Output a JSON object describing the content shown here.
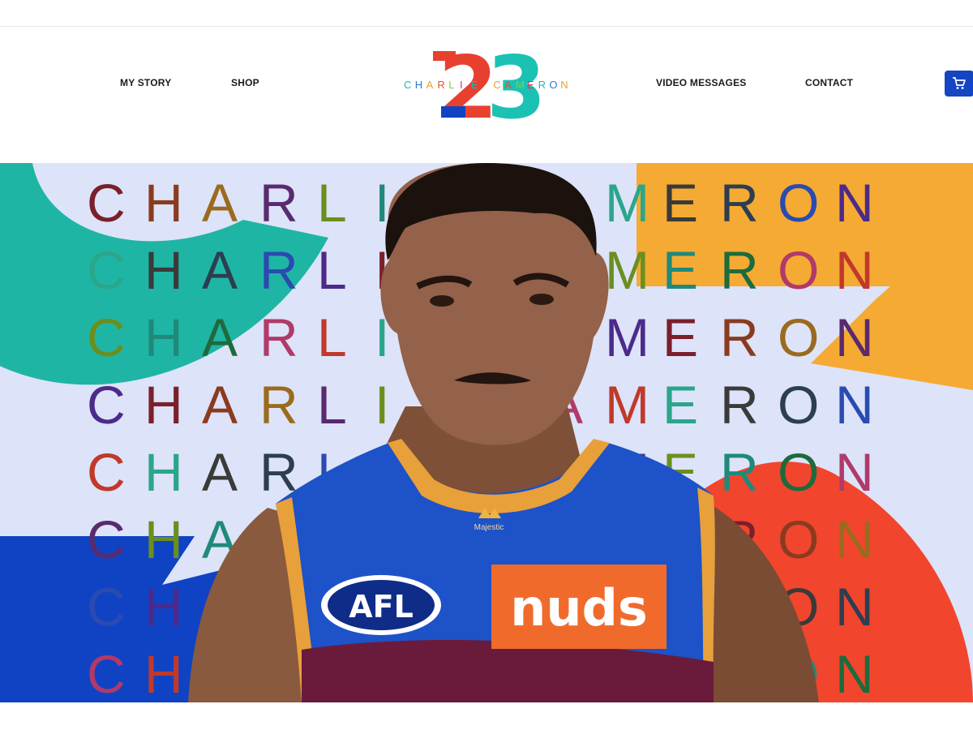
{
  "nav": {
    "left": [
      {
        "label": "MY STORY"
      },
      {
        "label": "SHOP"
      }
    ],
    "right": [
      {
        "label": "VIDEO MESSAGES"
      },
      {
        "label": "CONTACT"
      }
    ]
  },
  "logo": {
    "number": "23",
    "name": "CHARLIE CAMERON",
    "letter_colors": [
      "#1fb9b0",
      "#2b7bd6",
      "#e6a324",
      "#e8512d",
      "#7ad14a",
      "#d8326b",
      "#1fb9b0",
      "#2b7bd6",
      "#e6a324",
      "#e8512d",
      "#7ad14a",
      "#d8326b",
      "#1fb9b0",
      "#2b7bd6",
      "#e6a324"
    ]
  },
  "cart": {
    "icon": "cart-icon"
  },
  "hero": {
    "row_text": "CHARLIECAMERON",
    "row_count": 8,
    "jersey_brand": "Majestic",
    "jersey_logo": "AFL",
    "sponsor": "nuds",
    "colors": {
      "bg": "#dde3f8",
      "teal": "#1fb5a5",
      "orange": "#f5aa33",
      "red": "#f2452d",
      "blue": "#1043c4",
      "jersey_blue": "#1d52c8",
      "jersey_maroon": "#6a1b3c",
      "jersey_gold": "#e8a03a"
    }
  }
}
